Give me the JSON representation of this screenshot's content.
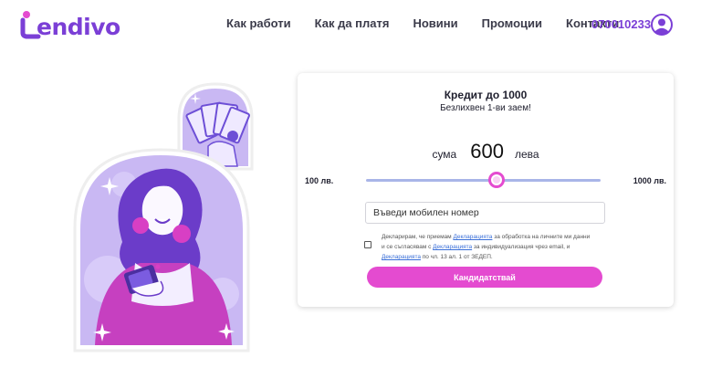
{
  "brand": {
    "name": "endivo",
    "accent": "#7b3fd6",
    "pink": "#e44bd0"
  },
  "nav": {
    "items": [
      {
        "label": "Как работи"
      },
      {
        "label": "Как да платя"
      },
      {
        "label": "Новини"
      },
      {
        "label": "Промоции"
      },
      {
        "label": "Контакти"
      }
    ],
    "phone": "070010233",
    "user_icon": "user-avatar-icon"
  },
  "loan": {
    "title": "Кредит до 1000",
    "subtitle": "Безлихвен 1-ви заем!",
    "amount_label": "сума",
    "amount_value": "600",
    "amount_unit": "лева",
    "min_label": "100 лв.",
    "max_label": "1000 лв.",
    "slider": {
      "min": 100,
      "max": 1000,
      "value": 600
    },
    "phone_placeholder": "Въведи мобилен номер",
    "consent": {
      "part1": "Декларирам, че приемам ",
      "link1": "Декларацията",
      "part2": " за обработка на личните ми данни и се съгласявам с ",
      "link2": "Декларацията",
      "part3": " за индивидуализация чрез email, и ",
      "link3": "Декларацията",
      "part4": " по чл. 13 ал. 1 от ЗЕДЕП."
    },
    "apply_label": "Кандидатствай"
  }
}
